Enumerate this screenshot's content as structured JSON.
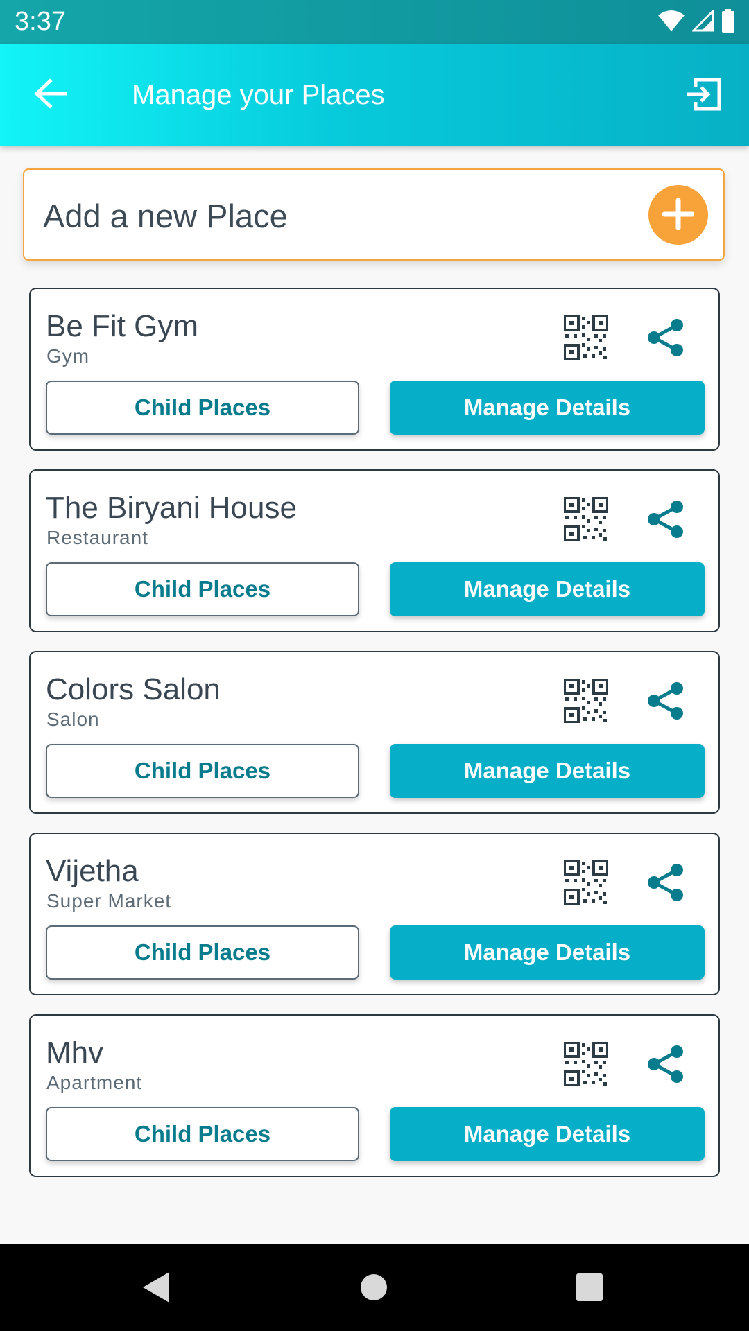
{
  "status_bar": {
    "time": "3:37",
    "icons": [
      "wifi-icon",
      "cell-signal-icon",
      "battery-icon"
    ]
  },
  "app_bar": {
    "title": "Manage your Places",
    "back_icon": "arrow-back-icon",
    "logout_icon": "logout-icon"
  },
  "add_place": {
    "label": "Add a new Place",
    "icon": "plus-icon"
  },
  "places": [
    {
      "name": "Be Fit Gym",
      "type": "Gym",
      "child_label": "Child Places",
      "manage_label": "Manage Details"
    },
    {
      "name": "The Biryani House",
      "type": "Restaurant",
      "child_label": "Child Places",
      "manage_label": "Manage Details"
    },
    {
      "name": "Colors Salon",
      "type": "Salon",
      "child_label": "Child Places",
      "manage_label": "Manage Details"
    },
    {
      "name": "Vijetha",
      "type": "Super Market",
      "child_label": "Child Places",
      "manage_label": "Manage Details"
    },
    {
      "name": "Mhv",
      "type": "Apartment",
      "child_label": "Child Places",
      "manage_label": "Manage Details"
    }
  ],
  "colors": {
    "accent_teal": "#07b0c5",
    "add_orange": "#f8a23a",
    "card_border": "#2e3a42"
  },
  "nav_bar": {
    "icons": [
      "nav-back-icon",
      "nav-home-icon",
      "nav-recents-icon"
    ]
  }
}
